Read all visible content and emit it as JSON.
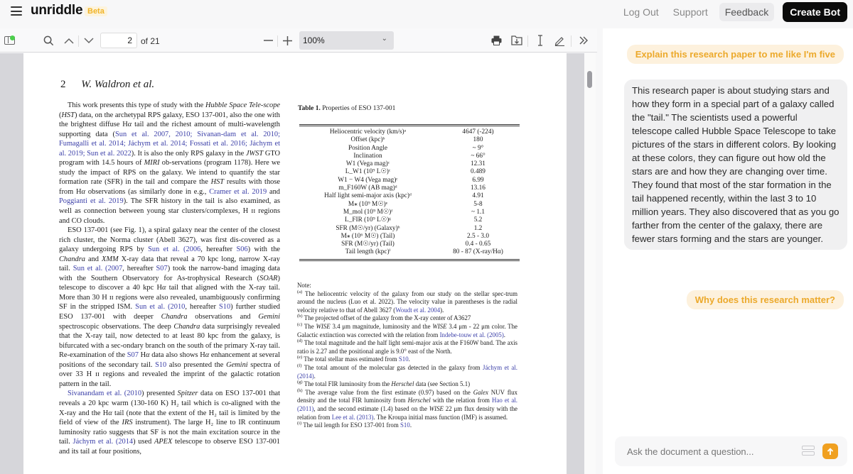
{
  "app": {
    "name": "unriddle",
    "badge": "Beta",
    "nav": {
      "logout": "Log Out",
      "support": "Support",
      "feedback": "Feedback",
      "create_bot": "Create Bot"
    }
  },
  "toolbar": {
    "current_page": "2",
    "page_total_label": "of 21",
    "zoom_level": "100%",
    "icons": {
      "sidebar": "sidebar-toggle-icon",
      "search": "search-icon",
      "prev": "chevron-up-icon",
      "next": "chevron-down-icon",
      "zoom_out": "minus-icon",
      "zoom_in": "plus-icon",
      "print": "printer-icon",
      "download": "download-icon",
      "text_select": "text-cursor-icon",
      "annotate": "pencil-icon",
      "more": "double-chevron-right-icon"
    }
  },
  "document": {
    "page_number": "2",
    "running_author": "W. Waldron et al.",
    "paragraphs": [
      [
        {
          "t": "This work presents this type of study with the "
        },
        {
          "t": "Hubble Space Tele-scope",
          "s": "it"
        },
        {
          "t": " ("
        },
        {
          "t": "HST",
          "s": "it"
        },
        {
          "t": ") data, on the archetypal RPS galaxy, ESO 137-001, also the one with the brightest diffuse H"
        },
        {
          "t": "α",
          "s": "it"
        },
        {
          "t": " tail and the richest amount of multi-wavelength supporting data ("
        },
        {
          "t": "Sun et al. 2007, 2010; Sivanan-dam et al. 2010; Fumagalli et al. 2014; Jáchym et al. 2014; Fossati et al. 2016; Jáchym et al. 2019; Sun et al. 2022",
          "s": "cite"
        },
        {
          "t": "). It is also the only RPS galaxy in the "
        },
        {
          "t": "JWST",
          "s": "it"
        },
        {
          "t": " GTO program with 14.5 hours of "
        },
        {
          "t": "MIRI",
          "s": "it"
        },
        {
          "t": " ob-servations (program 1178). Here we study the impact of RPS on the galaxy. We intend to quantify the star formation rate (SFR) in the tail and compare the "
        },
        {
          "t": "HST",
          "s": "it"
        },
        {
          "t": " results with those from H"
        },
        {
          "t": "α",
          "s": "it"
        },
        {
          "t": " observations (as similarly done in e.g., "
        },
        {
          "t": "Cramer et al. 2019",
          "s": "cite"
        },
        {
          "t": " and "
        },
        {
          "t": "Poggianti et al. 2019",
          "s": "cite"
        },
        {
          "t": "). The SFR history in the tail is also examined, as well as connection between young star clusters/complexes, H ɪɪ regions and CO clouds."
        }
      ],
      [
        {
          "t": "ESO 137-001 (see Fig. 1), a spiral galaxy near the center of the closest rich cluster, the Norma cluster (Abell 3627), was first dis-covered as a galaxy undergoing RPS by "
        },
        {
          "t": "Sun et al. (2006",
          "s": "cite"
        },
        {
          "t": ", hereafter "
        },
        {
          "t": "S06",
          "s": "cite"
        },
        {
          "t": ") with the "
        },
        {
          "t": "Chandra",
          "s": "it"
        },
        {
          "t": " and "
        },
        {
          "t": "XMM",
          "s": "it"
        },
        {
          "t": " X-ray data that reveal a 70 kpc long, narrow X-ray tail. "
        },
        {
          "t": "Sun et al. (2007",
          "s": "cite"
        },
        {
          "t": ", hereafter "
        },
        {
          "t": "S07",
          "s": "cite"
        },
        {
          "t": ") took the narrow-band imaging data with the Southern Observatory for As-trophysical Research ("
        },
        {
          "t": "SOAR",
          "s": "it"
        },
        {
          "t": ") telescope to discover a 40 kpc H"
        },
        {
          "t": "α",
          "s": "it"
        },
        {
          "t": " tail that aligned with the X-ray tail. More than 30 H ɪɪ regions were also revealed, unambiguously confirming SF in the stripped ISM. "
        },
        {
          "t": "Sun et al. (2010",
          "s": "cite"
        },
        {
          "t": ", hereafter "
        },
        {
          "t": "S10",
          "s": "cite"
        },
        {
          "t": ") further studied ESO 137-001 with deeper "
        },
        {
          "t": "Chandra",
          "s": "it"
        },
        {
          "t": " observations and "
        },
        {
          "t": "Gemini",
          "s": "it"
        },
        {
          "t": " spectroscopic observations. The deep "
        },
        {
          "t": "Chandra",
          "s": "it"
        },
        {
          "t": " data surprisingly revealed that the X-ray tail, now detected to at least 80 kpc from the galaxy, is bifurcated with a sec-ondary branch on the south of the primary X-ray tail. Re-examination of the "
        },
        {
          "t": "S07",
          "s": "cite"
        },
        {
          "t": " H"
        },
        {
          "t": "α",
          "s": "it"
        },
        {
          "t": " data also shows H"
        },
        {
          "t": "α",
          "s": "it"
        },
        {
          "t": " enhancement at several positions of the secondary tail. "
        },
        {
          "t": "S10",
          "s": "cite"
        },
        {
          "t": " also presented the "
        },
        {
          "t": "Gemini",
          "s": "it"
        },
        {
          "t": " spectra of over 33 H ɪɪ regions and revealed the imprint of the galactic rotation pattern in the tail."
        }
      ],
      [
        {
          "t": "Sivanandam et al. (2010",
          "s": "cite"
        },
        {
          "t": ") presented "
        },
        {
          "t": "Spitzer",
          "s": "it"
        },
        {
          "t": " data on ESO 137-001 that reveals a 20 kpc warm (130-160 K) H₂ tail which is co-aligned with the X-ray and the H"
        },
        {
          "t": "α",
          "s": "it"
        },
        {
          "t": " tail (note that the extent of the H₂ tail is limited by the field of view of the "
        },
        {
          "t": "IRS",
          "s": "it"
        },
        {
          "t": " instrument). The large H₂ line to IR continuum luminosity ratio suggests that SF is not the main excitation source in the tail. "
        },
        {
          "t": "Jáchym et al. (2014",
          "s": "cite"
        },
        {
          "t": ") used "
        },
        {
          "t": "APEX",
          "s": "it"
        },
        {
          "t": " telescope to observe ESO 137-001 and its tail at four positions,"
        }
      ]
    ],
    "table": {
      "caption_label": "Table 1.",
      "caption_text": "Properties of ESO 137-001",
      "rows": [
        {
          "k": "Heliocentric velocity (km/s)ᵃ",
          "v": "4647 (-224)"
        },
        {
          "k": "Offset (kpc)ᵇ",
          "v": "180"
        },
        {
          "k": "Position Angle",
          "v": "~ 9°"
        },
        {
          "k": "Inclination",
          "v": "~ 66°"
        },
        {
          "k": "W1 (Vega mag)ᶜ",
          "v": "12.31"
        },
        {
          "k": "L_W1 (10⁹ L☉)ᶜ",
          "v": "0.489"
        },
        {
          "k": "W1 − W4 (Vega mag)ᶜ",
          "v": "6.99"
        },
        {
          "k": "m_F160W (AB mag)ᵈ",
          "v": "13.16"
        },
        {
          "k": "Half light semi-major axis (kpc)ᵈ",
          "v": "4.91"
        },
        {
          "k": "M⁎ (10⁹ M☉)ᵉ",
          "v": "5-8"
        },
        {
          "k": "M_mol (10⁹ M☉)ᶠ",
          "v": "~ 1.1"
        },
        {
          "k": "L_FIR (10⁹ L☉)ᵍ",
          "v": "5.2"
        },
        {
          "k": "SFR (M☉/yr) (Galaxy)ʰ",
          "v": "1.2"
        },
        {
          "k": "M⁎ (10⁶ M☉) (Tail)",
          "v": "2.5 - 3.0"
        },
        {
          "k": "SFR (M☉/yr) (Tail)",
          "v": "0.4 - 0.65"
        },
        {
          "k": "Tail length (kpc)ⁱ",
          "v": "80 - 87 (X-ray/Hα)"
        }
      ]
    },
    "notes_title": "Note:",
    "notes": [
      {
        "m": "(a)",
        "parts": [
          {
            "t": " The heliocentric velocity of the galaxy from our study on the stellar spec-trum around the nucleus (Luo et al. 2022). The velocity value in parentheses is the radial velocity relative to that of Abell 3627 ("
          },
          {
            "t": "Woudt et al. 2004",
            "s": "cite"
          },
          {
            "t": ")."
          }
        ]
      },
      {
        "m": "(b)",
        "parts": [
          {
            "t": " The projected offset of the galaxy from the X-ray center of A3627"
          }
        ]
      },
      {
        "m": "(c)",
        "parts": [
          {
            "t": " The "
          },
          {
            "t": "WISE",
            "s": "it"
          },
          {
            "t": " 3.4 μm magnitude, luminosity and the "
          },
          {
            "t": "WISE",
            "s": "it"
          },
          {
            "t": " 3.4 μm - 22 μm color. The Galactic extinction was corrected with the relation from "
          },
          {
            "t": "Indebe-touw et al. (2005)",
            "s": "cite"
          },
          {
            "t": "."
          }
        ]
      },
      {
        "m": "(d)",
        "parts": [
          {
            "t": " The total magnitude and the half light semi-major axis at the F160W band. The axis ratio is 2.27 and the positional angle is 9.0° east of the North."
          }
        ]
      },
      {
        "m": "(e)",
        "parts": [
          {
            "t": " The total stellar mass estimated from "
          },
          {
            "t": "S10",
            "s": "cite"
          },
          {
            "t": "."
          }
        ]
      },
      {
        "m": "(f)",
        "parts": [
          {
            "t": " The total amount of the molecular gas detected in the galaxy from "
          },
          {
            "t": "Jáchym et al. (2014)",
            "s": "cite"
          },
          {
            "t": "."
          }
        ]
      },
      {
        "m": "(g)",
        "parts": [
          {
            "t": " The total FIR luminosity from the "
          },
          {
            "t": "Herschel",
            "s": "it"
          },
          {
            "t": " data (see Section 5.1)"
          }
        ]
      },
      {
        "m": "(h)",
        "parts": [
          {
            "t": " The average value from the first estimate (0.97) based on the "
          },
          {
            "t": "Galex",
            "s": "it"
          },
          {
            "t": " NUV flux density and the total FIR luminosity from "
          },
          {
            "t": "Herschel",
            "s": "it"
          },
          {
            "t": " with the relation from "
          },
          {
            "t": "Hao et al. (2011)",
            "s": "cite"
          },
          {
            "t": ", and the second estimate (1.4) based on the "
          },
          {
            "t": "WISE",
            "s": "it"
          },
          {
            "t": " 22 μm flux density with the relation from "
          },
          {
            "t": "Lee et al. (2013)",
            "s": "cite"
          },
          {
            "t": ". The Kroupa initial mass function (IMF) is assumed."
          }
        ]
      },
      {
        "m": "(i)",
        "parts": [
          {
            "t": " The tail length for ESO 137-001 from "
          },
          {
            "t": "S10",
            "s": "cite"
          },
          {
            "t": "."
          }
        ]
      }
    ]
  },
  "chat": {
    "messages": [
      {
        "role": "user",
        "text": "Explain this research paper to me like I'm five"
      },
      {
        "role": "assistant",
        "text": "This research paper is about studying stars and how they form in a special part of a galaxy called the \"tail.\" The scientists used a powerful telescope called Hubble Space Telescope to take pictures of the stars in different colors. By looking at these colors, they can figure out how old the stars are and how they are changing over time. They found that most of the star formation in the tail happened recently, within the last 3 to 10 million years. They also discovered that as you go farther from the center of the galaxy, there are fewer stars forming and the stars are younger."
      },
      {
        "role": "user",
        "text": "Why does this research matter?"
      }
    ],
    "input_placeholder": "Ask the document a question...",
    "accent_color": "#f0a020"
  }
}
